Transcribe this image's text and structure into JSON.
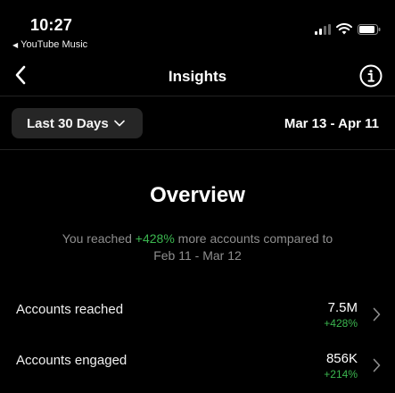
{
  "status_bar": {
    "time": "10:27",
    "back_app": "YouTube Music",
    "icons": [
      "signal-icon",
      "wifi-icon",
      "battery-icon"
    ]
  },
  "nav": {
    "title": "Insights",
    "back_icon": "chevron-left-icon",
    "info_icon": "info-icon"
  },
  "filter": {
    "range_label": "Last 30 Days",
    "date_range": "Mar 13 - Apr 11"
  },
  "overview": {
    "title": "Overview",
    "summary_prefix": "You reached ",
    "summary_highlight": "+428%",
    "summary_suffix": " more accounts compared to",
    "summary_line2": "Feb 11 - Mar 12"
  },
  "metrics": [
    {
      "label": "Accounts reached",
      "value": "7.5M",
      "change": "+428%"
    },
    {
      "label": "Accounts engaged",
      "value": "856K",
      "change": "+214%"
    }
  ],
  "colors": {
    "background": "#000000",
    "positive": "#3bb64f",
    "muted_text": "#8e8e8e",
    "button_bg": "#262626"
  }
}
